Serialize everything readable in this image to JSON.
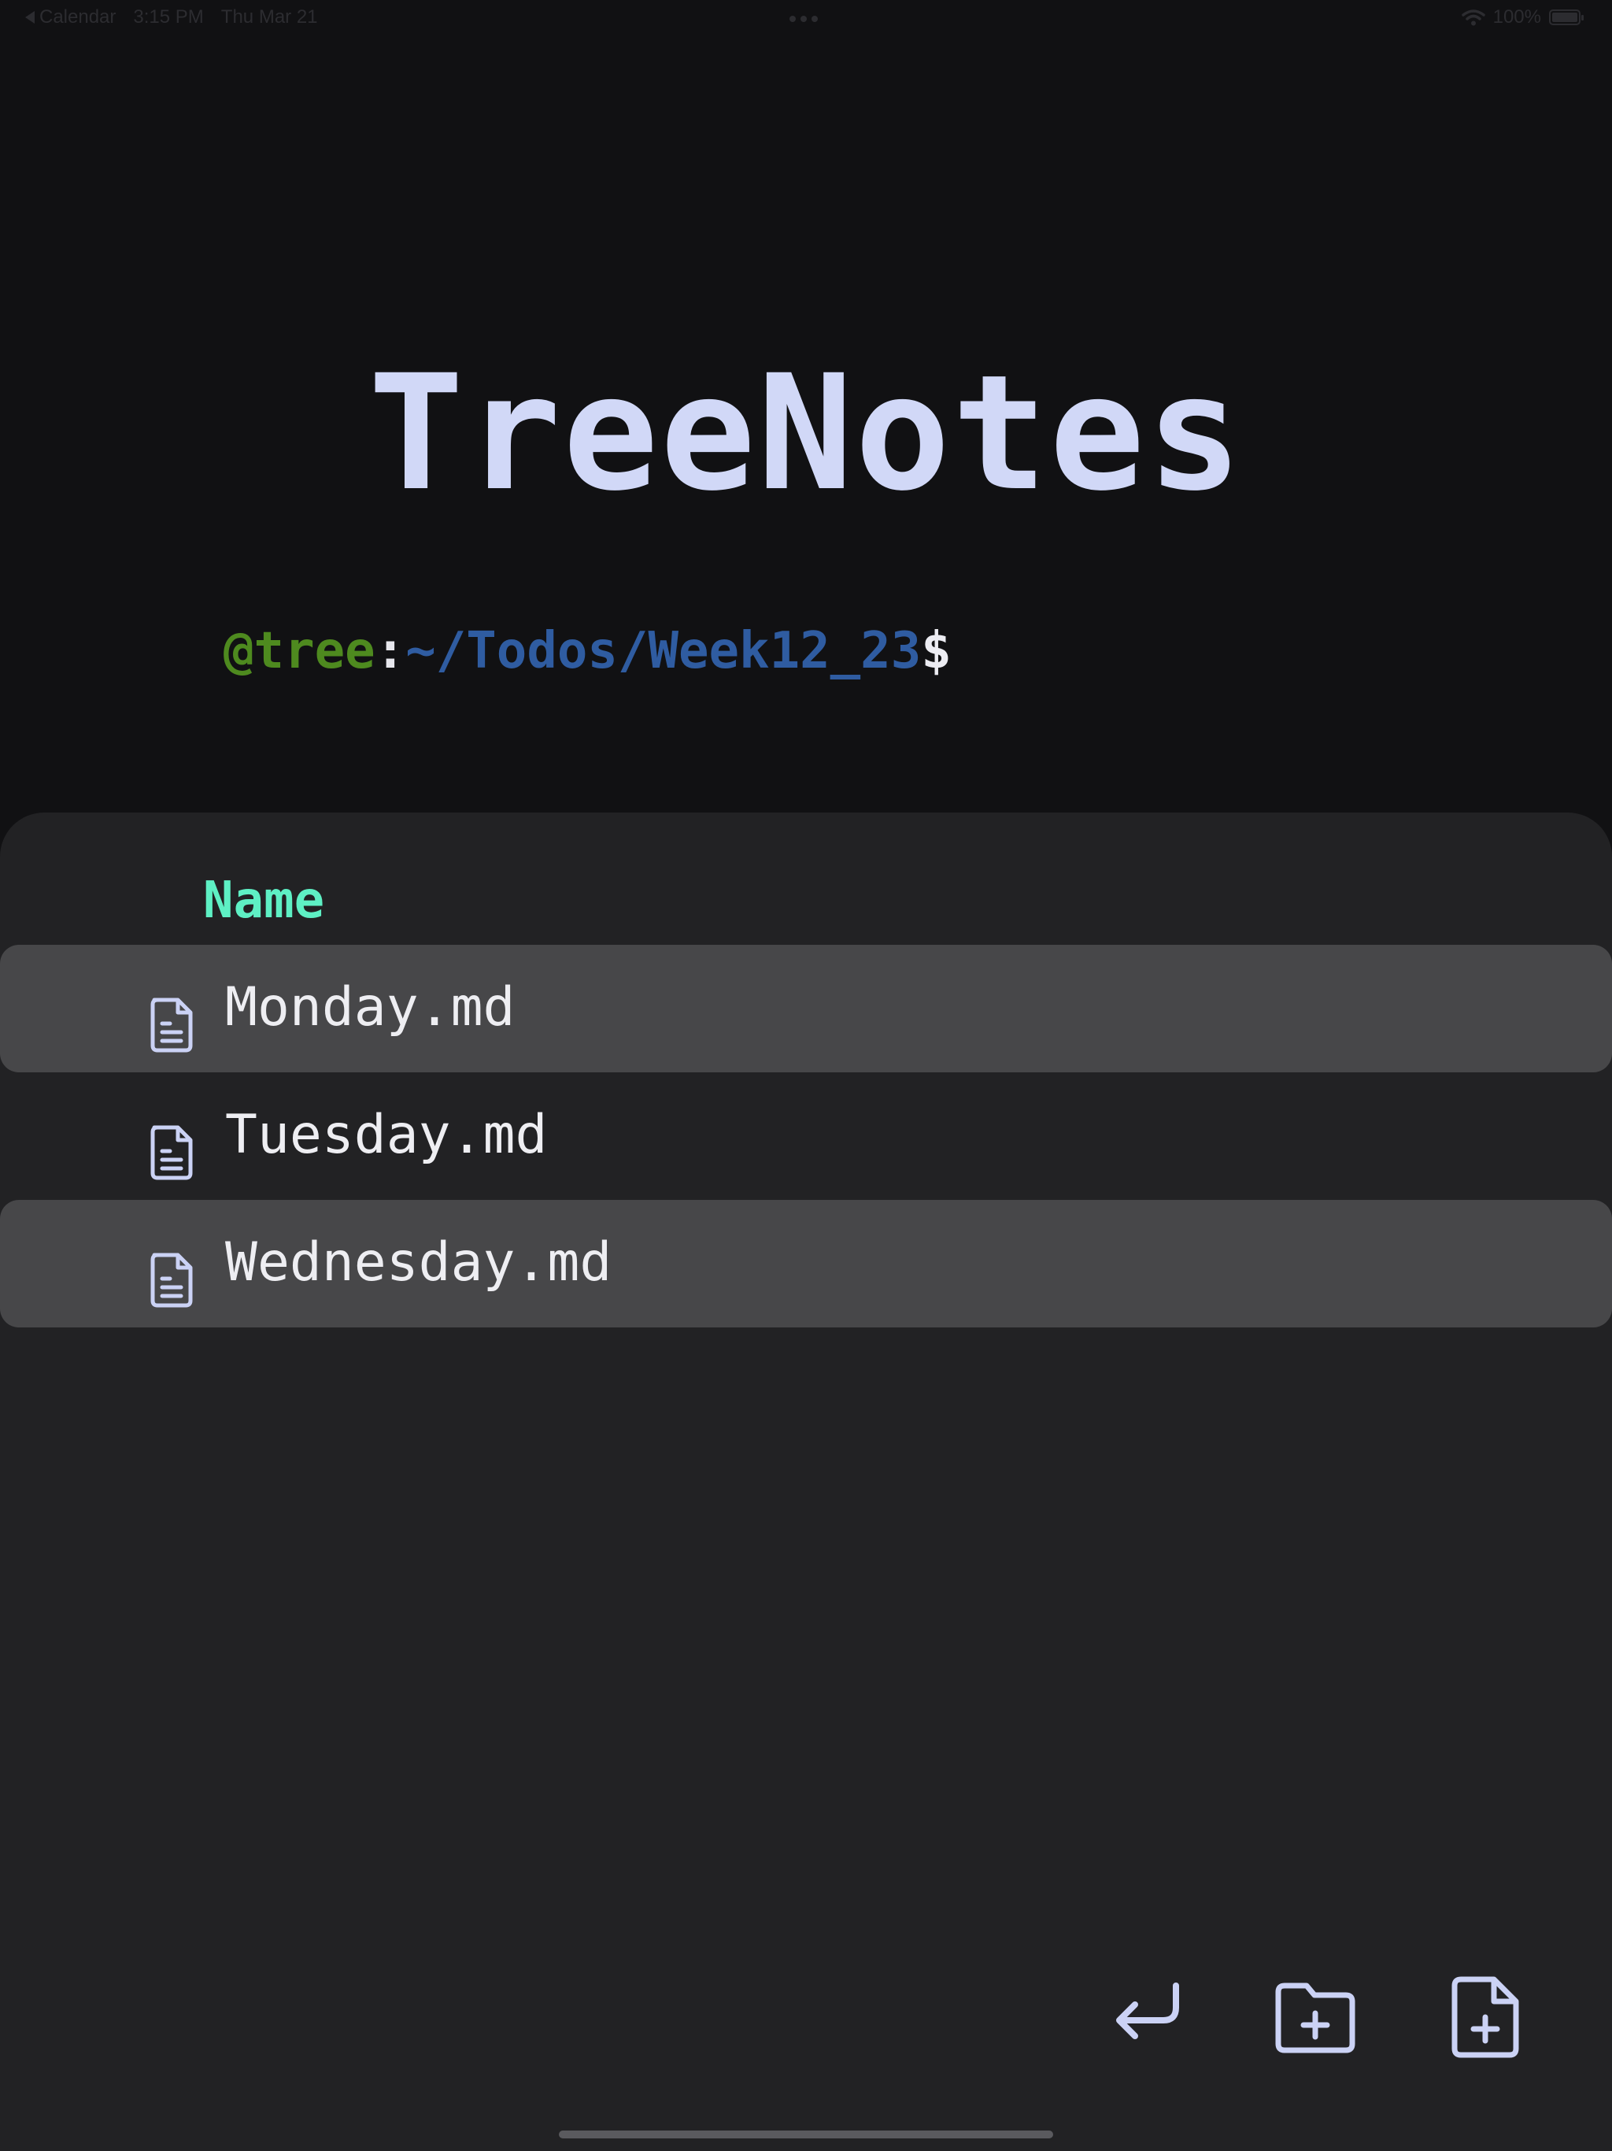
{
  "status_bar": {
    "back_app": "Calendar",
    "time": "3:15 PM",
    "date": "Thu Mar 21",
    "battery": "100%",
    "wifi_icon": "wifi-icon",
    "battery_icon": "battery-icon"
  },
  "app": {
    "title": "TreeNotes"
  },
  "prompt": {
    "user": "@tree",
    "separator": ":",
    "path": "~/Todos/Week12_23",
    "symbol": "$"
  },
  "file_list": {
    "column_header": "Name",
    "files": [
      {
        "name": "Monday.md",
        "icon": "file-text-icon"
      },
      {
        "name": "Tuesday.md",
        "icon": "file-text-icon"
      },
      {
        "name": "Wednesday.md",
        "icon": "file-text-icon"
      }
    ]
  },
  "toolbar": {
    "buttons": [
      {
        "icon": "return-icon"
      },
      {
        "icon": "folder-plus-icon"
      },
      {
        "icon": "file-plus-icon"
      }
    ]
  },
  "colors": {
    "background": "#111113",
    "panel": "#222224",
    "row_stripe": "#474749",
    "title": "#d1d8f7",
    "header_accent": "#5ef0c4",
    "prompt_user": "#4e8a1f",
    "prompt_path": "#2f5ca1",
    "icon_stroke": "#cbd2f5"
  }
}
